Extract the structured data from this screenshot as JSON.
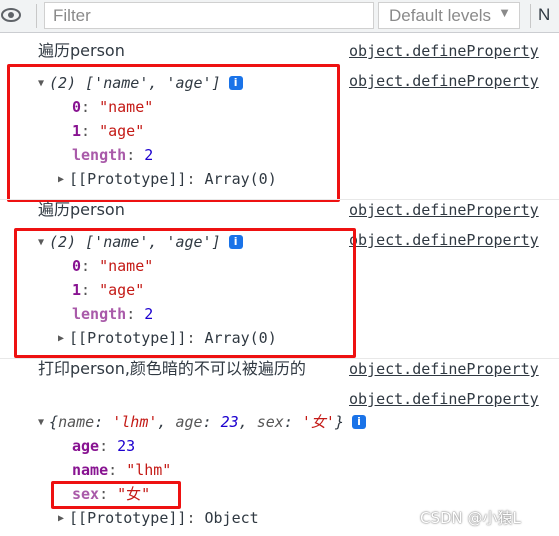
{
  "toolbar": {
    "filter_placeholder": "Filter",
    "levels_label": "Default levels",
    "levels_caret": "▼",
    "issues_label": "N",
    "eye_icon": "eye-icon"
  },
  "source_link": "object.defineProperty",
  "block1": {
    "log_text": "遍历person",
    "array_summary": "(2) ['name', 'age']",
    "items": [
      {
        "key": "0",
        "value": "\"name\""
      },
      {
        "key": "1",
        "value": "\"age\""
      }
    ],
    "length_key": "length",
    "length_value": "2",
    "proto_key": "[[Prototype]]",
    "proto_value": "Array(0)"
  },
  "block2": {
    "log_text": "遍历person",
    "array_summary": "(2) ['name', 'age']",
    "items": [
      {
        "key": "0",
        "value": "\"name\""
      },
      {
        "key": "1",
        "value": "\"age\""
      }
    ],
    "length_key": "length",
    "length_value": "2",
    "proto_key": "[[Prototype]]",
    "proto_value": "Array(0)"
  },
  "block3": {
    "log_text": "打印person,颜色暗的不可以被遍历的",
    "object_summary_open": "{",
    "obj_name_key": "name",
    "obj_name_val": "'lhm'",
    "obj_age_key": "age",
    "obj_age_val": "23",
    "obj_sex_key": "sex",
    "obj_sex_val": "'女'",
    "object_summary_close": "}",
    "props": [
      {
        "key": "age",
        "value": "23"
      },
      {
        "key": "name",
        "value": "\"lhm\""
      },
      {
        "key": "sex",
        "value": "\"女\""
      }
    ],
    "proto_key": "[[Prototype]]",
    "proto_value": "Object"
  },
  "watermark": "CSDN @小猿L",
  "colors": {
    "highlight_box": "#ee1111",
    "string": "#c41a16",
    "number": "#1c00cf",
    "key": "#881391",
    "info_badge": "#1a73e8"
  }
}
